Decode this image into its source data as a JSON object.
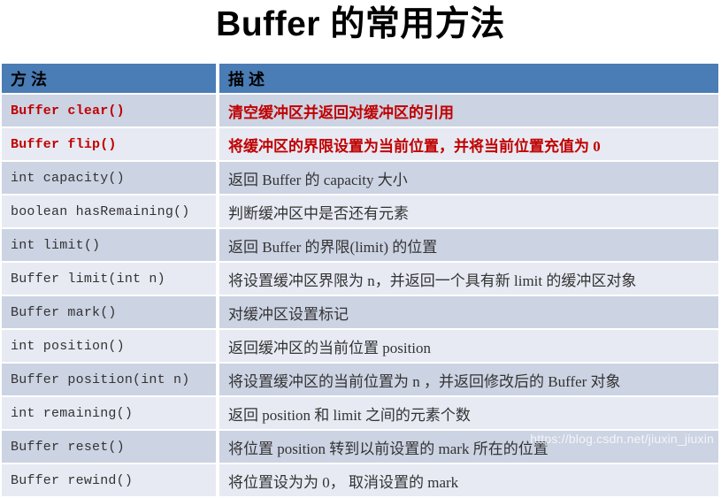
{
  "title": "Buffer 的常用方法",
  "table": {
    "headers": {
      "method": "方 法",
      "description": "描 述"
    },
    "header_bg": "#4a7cb5",
    "band_dark": "#ccd3e3",
    "band_light": "#e7eaf3",
    "highlight_color": "#c00000",
    "rows": [
      {
        "method": "Buffer clear()",
        "description": "清空缓冲区并返回对缓冲区的引用",
        "highlight": true
      },
      {
        "method": "Buffer flip()",
        "description": "将缓冲区的界限设置为当前位置，并将当前位置充值为 0",
        "highlight": true
      },
      {
        "method": "int capacity()",
        "description": "返回 Buffer 的 capacity 大小",
        "highlight": false
      },
      {
        "method": "boolean hasRemaining()",
        "description": "判断缓冲区中是否还有元素",
        "highlight": false
      },
      {
        "method": "int limit()",
        "description": "返回 Buffer 的界限(limit) 的位置",
        "highlight": false
      },
      {
        "method": "Buffer limit(int n)",
        "description": "将设置缓冲区界限为 n，并返回一个具有新 limit 的缓冲区对象",
        "highlight": false
      },
      {
        "method": "Buffer mark()",
        "description": "对缓冲区设置标记",
        "highlight": false
      },
      {
        "method": "int position()",
        "description": "返回缓冲区的当前位置 position",
        "highlight": false
      },
      {
        "method": "Buffer position(int n)",
        "description": "将设置缓冲区的当前位置为 n ，并返回修改后的 Buffer 对象",
        "highlight": false
      },
      {
        "method": "int remaining()",
        "description": "返回 position 和 limit 之间的元素个数",
        "highlight": false
      },
      {
        "method": "Buffer reset()",
        "description": "将位置 position 转到以前设置的   mark 所在的位置",
        "highlight": false
      },
      {
        "method": "Buffer rewind()",
        "description": "将位置设为为 0， 取消设置的 mark",
        "highlight": false
      }
    ]
  },
  "watermark": "https://blog.csdn.net/jiuxin_jiuxin"
}
